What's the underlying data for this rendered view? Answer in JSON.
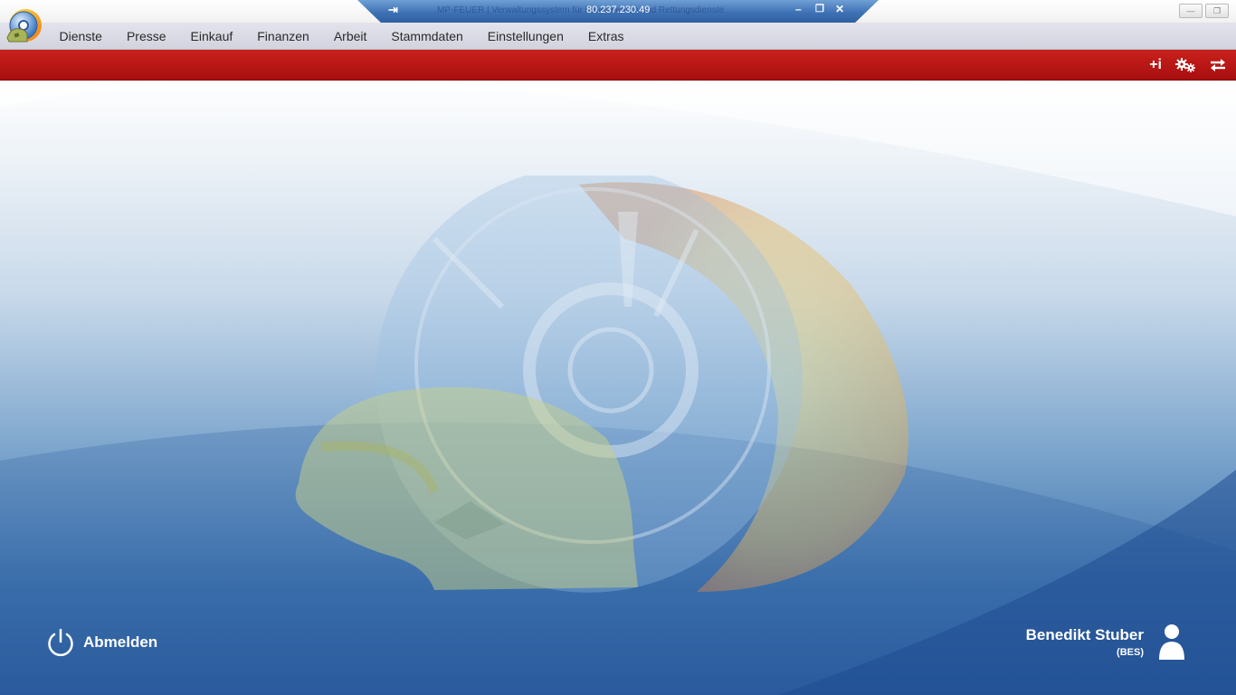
{
  "titlebar": {
    "title_text": "MP-FEUER | Verwaltungssystem für Feuerwehren und Rettungsdienste",
    "rdp_ip": "80.237.230.49",
    "rdp_pin_symbol": "⇥",
    "rdp_minimize_symbol": "–",
    "rdp_restore_symbol": "❐",
    "rdp_close_symbol": "✕",
    "window_minimize_symbol": "—",
    "window_restore_symbol": "❐"
  },
  "menu": {
    "items": [
      {
        "label": "Dienste"
      },
      {
        "label": "Presse"
      },
      {
        "label": "Einkauf"
      },
      {
        "label": "Finanzen"
      },
      {
        "label": "Arbeit"
      },
      {
        "label": "Stammdaten"
      },
      {
        "label": "Einstellungen"
      },
      {
        "label": "Extras"
      }
    ]
  },
  "toolbar": {
    "info_icon": "plus-info-icon",
    "info_symbol": "+i",
    "settings_icon": "gears-icon",
    "switch_icon": "switch-arrows-icon",
    "accent_color": "#b8140f"
  },
  "footer": {
    "logout_label": "Abmelden",
    "user_name": "Benedikt Stuber",
    "user_code": "(BES)"
  }
}
